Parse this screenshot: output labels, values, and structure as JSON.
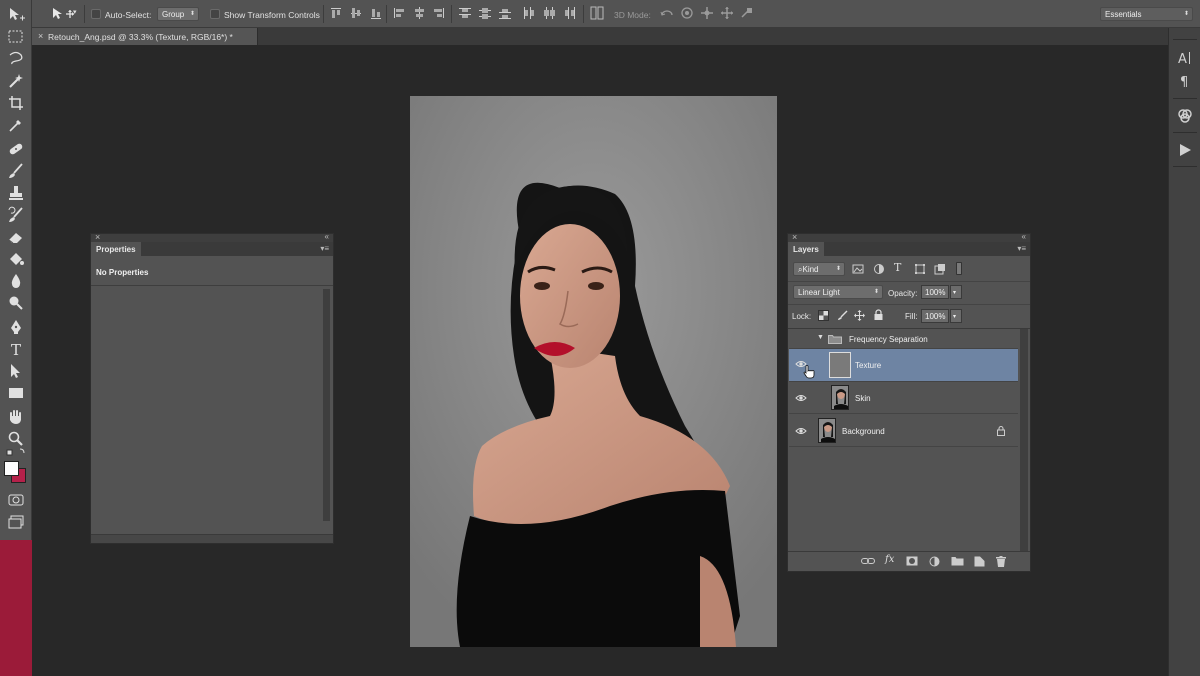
{
  "colors": {
    "ui_bg": "#535353",
    "workspace": "#282828",
    "selection": "#6e84a3",
    "foreground_swatch": "#ffffff",
    "background_swatch": "#b5214a"
  },
  "options_bar": {
    "tool_icon": "move-tool-icon",
    "auto_select_label": "Auto-Select:",
    "auto_select_value": "Group",
    "show_transform_label": "Show Transform Controls",
    "mode_3d_label": "3D Mode:",
    "workspace_value": "Essentials"
  },
  "document": {
    "tab_title": "Retouch_Ang.psd @ 33.3% (Texture, RGB/16*) *"
  },
  "tools": [
    "move-tool",
    "marquee-tool",
    "lasso-tool",
    "quick-select-tool",
    "crop-tool",
    "eyedropper-tool",
    "healing-brush-tool",
    "brush-tool",
    "clone-stamp-tool",
    "history-brush-tool",
    "eraser-tool",
    "paint-bucket-tool",
    "blur-tool",
    "dodge-tool",
    "pen-tool",
    "type-tool",
    "path-selection-tool",
    "rectangle-tool",
    "hand-tool",
    "zoom-tool"
  ],
  "right_dock": [
    "character-panel",
    "paragraph-panel",
    "color-panel",
    "actions-panel"
  ],
  "properties_panel": {
    "title": "Properties",
    "message": "No Properties"
  },
  "layers_panel": {
    "title": "Layers",
    "filter_kind": "Kind",
    "blend_mode": "Linear Light",
    "opacity_label": "Opacity:",
    "opacity_value": "100%",
    "lock_label": "Lock:",
    "fill_label": "Fill:",
    "fill_value": "100%",
    "group": {
      "name": "Frequency Separation",
      "expanded": true
    },
    "layers": [
      {
        "name": "Texture",
        "selected": true,
        "visible": true
      },
      {
        "name": "Skin",
        "selected": false,
        "visible": true
      },
      {
        "name": "Background",
        "selected": false,
        "visible": true,
        "locked": true
      }
    ],
    "bottom_buttons": [
      "link-layers",
      "add-layer-style",
      "add-mask",
      "new-adjustment-layer",
      "new-group",
      "new-layer",
      "delete-layer"
    ]
  }
}
